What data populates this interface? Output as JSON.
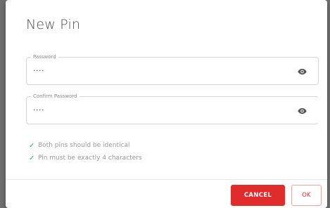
{
  "dialog": {
    "title": "New Pin",
    "password": {
      "label": "Password",
      "value": "····",
      "toggle_icon": "eye-icon"
    },
    "confirm_password": {
      "label": "Confirm Password",
      "value": "····",
      "toggle_icon": "eye-icon"
    },
    "rules": [
      {
        "check": "✓",
        "text": "Both pins should be identical"
      },
      {
        "check": "✓",
        "text": "Pin must be exactly 4 characters"
      }
    ],
    "buttons": {
      "cancel": "CANCEL",
      "ok": "OK"
    }
  },
  "colors": {
    "accent": "#e02c2c",
    "success": "#3aa855",
    "overlay": "#6f6f6f"
  }
}
